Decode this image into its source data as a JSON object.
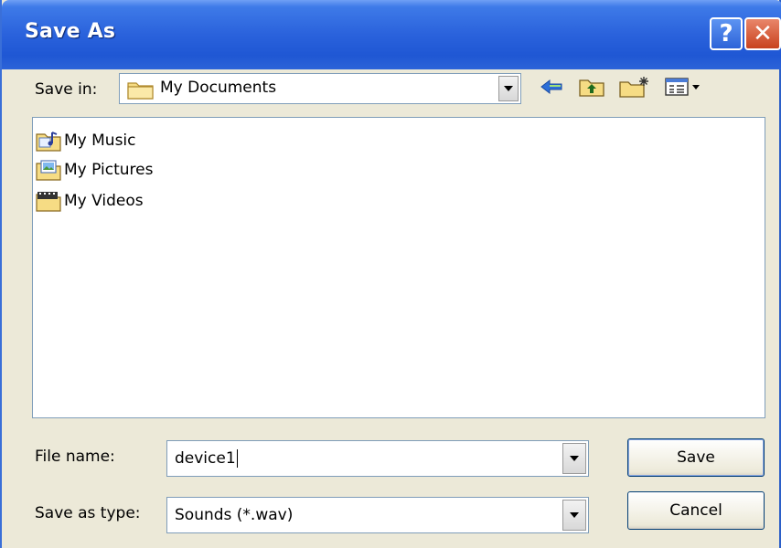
{
  "window": {
    "title": "Save As",
    "help_icon": "?",
    "close_icon": "✕"
  },
  "toolbar": {
    "save_in_label": "Save in:",
    "save_in_value": "My Documents",
    "icons": [
      "back-arrow-icon",
      "up-one-level-icon",
      "new-folder-icon",
      "view-menu-icon"
    ]
  },
  "files": [
    {
      "name": "My Music",
      "icon": "music-folder-icon"
    },
    {
      "name": "My Pictures",
      "icon": "pictures-folder-icon"
    },
    {
      "name": "My Videos",
      "icon": "videos-folder-icon"
    }
  ],
  "form": {
    "file_name_label": "File name:",
    "file_name_value": "device1",
    "save_type_label": "Save as type:",
    "save_type_value": "Sounds (*.wav)"
  },
  "buttons": {
    "save": "Save",
    "cancel": "Cancel"
  }
}
